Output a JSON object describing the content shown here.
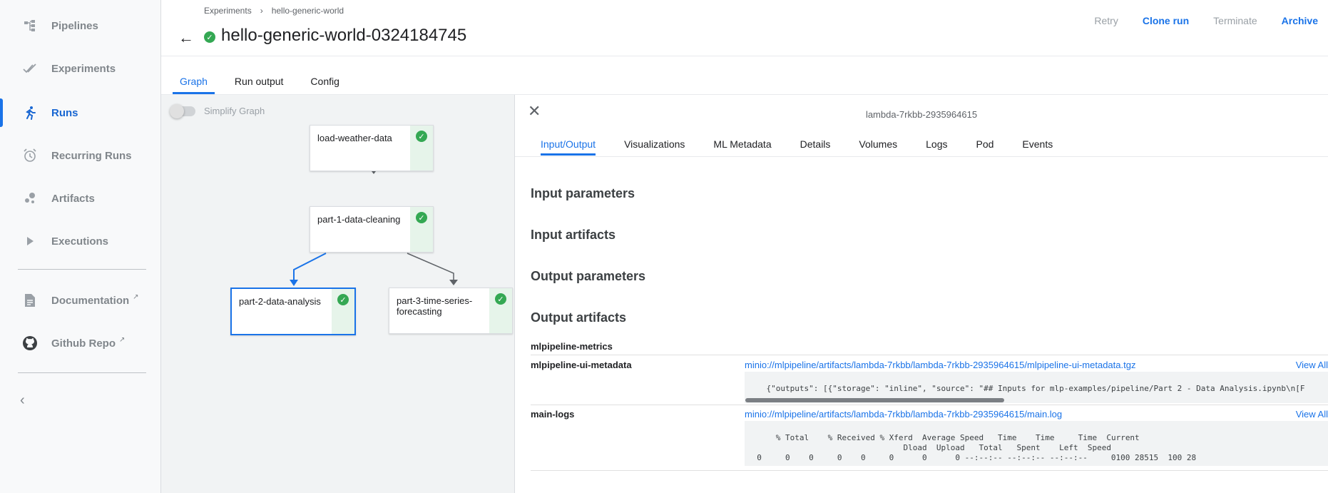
{
  "sidebar": {
    "items": [
      {
        "label": "Pipelines",
        "icon": "pipelines-icon"
      },
      {
        "label": "Experiments",
        "icon": "experiments-icon"
      },
      {
        "label": "Runs",
        "icon": "runs-icon"
      },
      {
        "label": "Recurring Runs",
        "icon": "alarm-icon"
      },
      {
        "label": "Artifacts",
        "icon": "artifacts-icon"
      },
      {
        "label": "Executions",
        "icon": "play-icon"
      }
    ],
    "active": "Runs",
    "links": [
      {
        "label": "Documentation",
        "icon": "document-icon"
      },
      {
        "label": "Github Repo",
        "icon": "github-icon"
      }
    ],
    "collapse_glyph": "‹"
  },
  "header": {
    "breadcrumb": [
      "Experiments",
      "hello-generic-world"
    ],
    "breadcrumb_sep": "›",
    "title": "hello-generic-world-0324184745",
    "actions": {
      "retry": "Retry",
      "clone": "Clone run",
      "terminate": "Terminate",
      "archive": "Archive"
    }
  },
  "tabs": [
    "Graph",
    "Run output",
    "Config"
  ],
  "graph": {
    "toggle_label": "Simplify Graph",
    "nodes": [
      "load-weather-data",
      "part-1-data-cleaning",
      "part-2-data-analysis",
      "part-3-time-series-forecasting"
    ]
  },
  "panel": {
    "pod_name": "lambda-7rkbb-2935964615",
    "tabs": [
      "Input/Output",
      "Visualizations",
      "ML Metadata",
      "Details",
      "Volumes",
      "Logs",
      "Pod",
      "Events"
    ],
    "sections": [
      "Input parameters",
      "Input artifacts",
      "Output parameters",
      "Output artifacts"
    ],
    "artifacts": [
      {
        "name": "mlpipeline-metrics"
      },
      {
        "name": "mlpipeline-ui-metadata",
        "link": "minio://mlpipeline/artifacts/lambda-7rkbb/lambda-7rkbb-2935964615/mlpipeline-ui-metadata.tgz",
        "view_all": "View All",
        "preview": "{\"outputs\": [{\"storage\": \"inline\", \"source\": \"## Inputs for mlp-examples/pipeline/Part 2 - Data Analysis.ipynb\\n[F\n..."
      },
      {
        "name": "main-logs",
        "link": "minio://mlpipeline/artifacts/lambda-7rkbb/lambda-7rkbb-2935964615/main.log",
        "view_all": "View All",
        "preview": "  % Total    % Received % Xferd  Average Speed   Time    Time     Time  Current\n                                 Dload  Upload   Total   Spent    Left  Speed\n  0     0    0     0    0     0      0      0 --:--:-- --:--:-- --:--:--     0100 28515  100 28\n..."
      }
    ]
  },
  "colors": {
    "accent": "#1a73e8",
    "success": "#34a853",
    "success_bg": "#e6f4ea"
  }
}
